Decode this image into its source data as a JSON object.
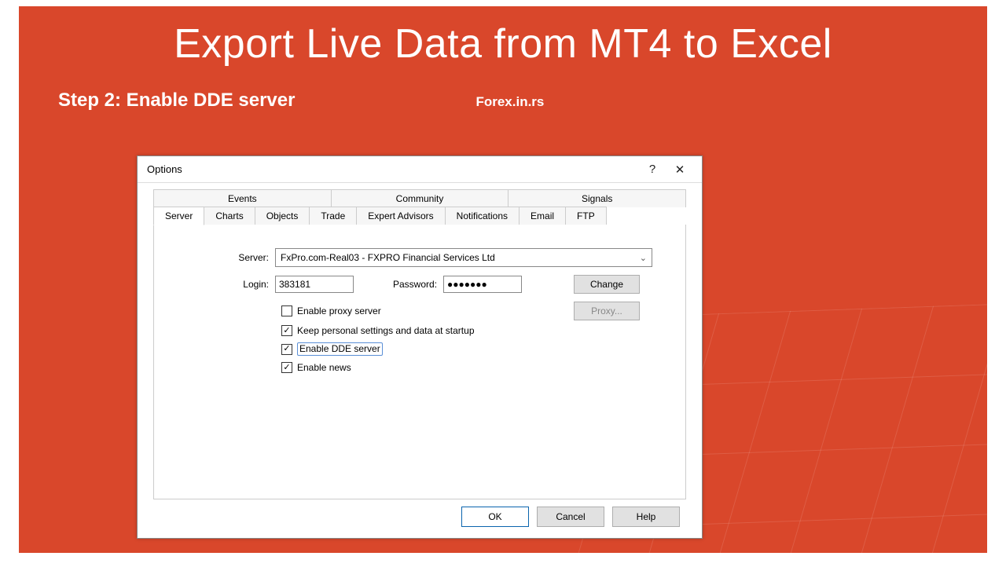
{
  "slide": {
    "title": "Export Live Data from MT4 to Excel",
    "step": "Step 2: Enable DDE server",
    "brand": "Forex.in.rs"
  },
  "dialog": {
    "title": "Options",
    "tabs_top": [
      "Events",
      "Community",
      "Signals"
    ],
    "tabs_bottom": [
      "Server",
      "Charts",
      "Objects",
      "Trade",
      "Expert Advisors",
      "Notifications",
      "Email",
      "FTP"
    ],
    "active_tab": "Server",
    "server_label": "Server:",
    "server_value": "FxPro.com-Real03 - FXPRO Financial Services Ltd",
    "login_label": "Login:",
    "login_value": "383181",
    "password_label": "Password:",
    "password_value": "●●●●●●●",
    "change_btn": "Change",
    "proxy_btn": "Proxy...",
    "checkboxes": {
      "proxy": {
        "label": "Enable proxy server",
        "checked": false
      },
      "keep": {
        "label": "Keep personal settings and data at startup",
        "checked": true
      },
      "dde": {
        "label": "Enable DDE server",
        "checked": true
      },
      "news": {
        "label": "Enable news",
        "checked": true
      }
    },
    "buttons": {
      "ok": "OK",
      "cancel": "Cancel",
      "help": "Help"
    }
  }
}
